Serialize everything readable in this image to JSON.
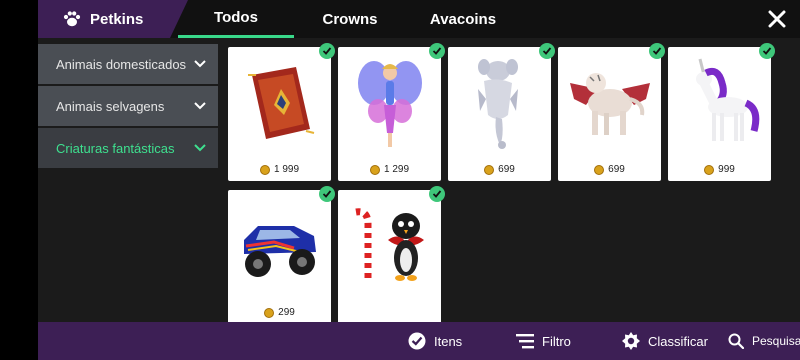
{
  "header": {
    "brand": "Petkins",
    "brand_icon": "paw-icon",
    "tabs": [
      {
        "label": "Todos",
        "active": true
      },
      {
        "label": "Crowns",
        "active": false
      },
      {
        "label": "Avacoins",
        "active": false
      }
    ],
    "close_icon": "close-icon"
  },
  "sidebar": {
    "items": [
      {
        "label": "Animais domesticados",
        "active": false
      },
      {
        "label": "Animais selvagens",
        "active": false
      },
      {
        "label": "Criaturas fantásticas",
        "active": true
      }
    ]
  },
  "items": [
    {
      "name": "flying-carpet",
      "price": "1 999",
      "owned": true
    },
    {
      "name": "fairy",
      "price": "1 299",
      "owned": true
    },
    {
      "name": "ghost-dragon",
      "price": "699",
      "owned": true
    },
    {
      "name": "winged-tiger",
      "price": "699",
      "owned": true
    },
    {
      "name": "unicorn",
      "price": "999",
      "owned": true
    },
    {
      "name": "monster-truck",
      "price": "299",
      "owned": true
    },
    {
      "name": "penguin-candy-cane",
      "price": "",
      "owned": true
    }
  ],
  "footer": {
    "items_label": "Itens",
    "filter_label": "Filtro",
    "sort_label": "Classificar",
    "search_label": "Pesquisa"
  },
  "colors": {
    "accent": "#39d98a",
    "brand_purple": "#3d1f55",
    "check_green": "#3ec77a",
    "coin": "#d9a21c"
  }
}
